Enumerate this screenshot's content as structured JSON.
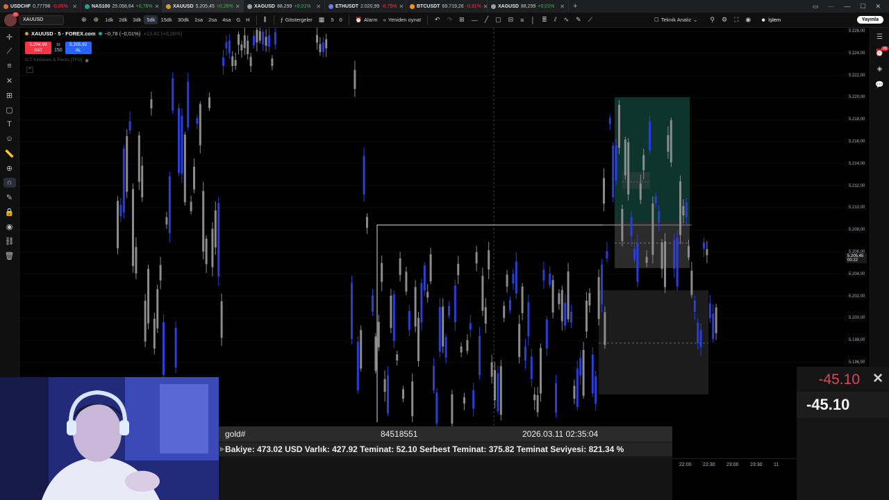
{
  "tabs": [
    {
      "name": "USDCHF",
      "value": "0,77798",
      "change": "-0,05%",
      "dir": "down",
      "color": "#e06c2c",
      "active": false
    },
    {
      "name": "NAS100",
      "value": "25.058,64",
      "change": "+0,76%",
      "dir": "up",
      "color": "#2a9d8f",
      "active": false
    },
    {
      "name": "XAUUSD",
      "value": "5.205,45",
      "change": "+0,26%",
      "dir": "up",
      "color": "#d4a017",
      "active": true
    },
    {
      "name": "XAGUSD",
      "value": "88,299",
      "change": "+0,01%",
      "dir": "up",
      "color": "#9aa0a6",
      "active": false
    },
    {
      "name": "ETHUSDT",
      "value": "2.020,99",
      "change": "-0,75%",
      "dir": "down",
      "color": "#627eea",
      "active": false
    },
    {
      "name": "BTCUSDT",
      "value": "69.719,26",
      "change": "-0,31%",
      "dir": "down",
      "color": "#f7931a",
      "active": false
    },
    {
      "name": "XAGUSD",
      "value": "88,299",
      "change": "+0,01%",
      "dir": "up",
      "color": "#9aa0a6",
      "active": false
    }
  ],
  "toolbar": {
    "badge": "11",
    "symbol": "XAUUSD",
    "intervals": [
      "1dk",
      "2dk",
      "3dk",
      "5dk",
      "15dk",
      "30dk",
      "1sa",
      "2sa",
      "4sa",
      "G",
      "H"
    ],
    "active_interval": "5dk",
    "indicators_label": "Göstergeler",
    "alarm_label": "Alarm",
    "replay_label": "Yeniden oynat",
    "layout_count_1": "5",
    "layout_count_2": "0",
    "analysis_label": "Teknik Analiz",
    "trade_label": "İşlem",
    "publish_label": "Yayınla"
  },
  "legend": {
    "symbol": "XAUUSD · 5 · FOREX.com",
    "change": "−0,78 (−0,01%)",
    "change2": "+13,42 (+0,26%)",
    "sell_price": "5.204,99",
    "sell_label": "SAT",
    "buy_price": "5.205,92",
    "buy_label": "AL",
    "spread_top": "93",
    "spread_bottom": "150",
    "indicator": "ICT Killzones & Pivots [TFO]"
  },
  "price_axis": {
    "labels": [
      "5.226,00",
      "5.224,00",
      "5.222,00",
      "5.220,00",
      "5.218,00",
      "5.216,00",
      "5.214,00",
      "5.212,00",
      "5.210,00",
      "5.208,00",
      "5.206,00",
      "5.204,00",
      "5.202,00",
      "5.200,00",
      "5.198,00",
      "5.196,00"
    ],
    "current_price": "5.205,45",
    "countdown": "00:22"
  },
  "time_axis": [
    "22:00",
    "22:30",
    "23:00",
    "23:30",
    "11"
  ],
  "mt_overlay": {
    "symbol": "gold#",
    "ticket": "84518551",
    "datetime": "2026.03.11 02:35:04",
    "account_line": "Bakiye: 473.02 USD   Varlık: 427.92   Teminat: 52.10   Serbest Teminat: 375.82   Teminat Seviyesi: 821.34 %",
    "pnl_top": "-45.10",
    "pnl_main": "-45.10"
  },
  "colors": {
    "bull": "#2a3fd6",
    "bear": "#8c8c8c",
    "profit_zone": "#0e3b33",
    "loss_zone": "#333333"
  }
}
